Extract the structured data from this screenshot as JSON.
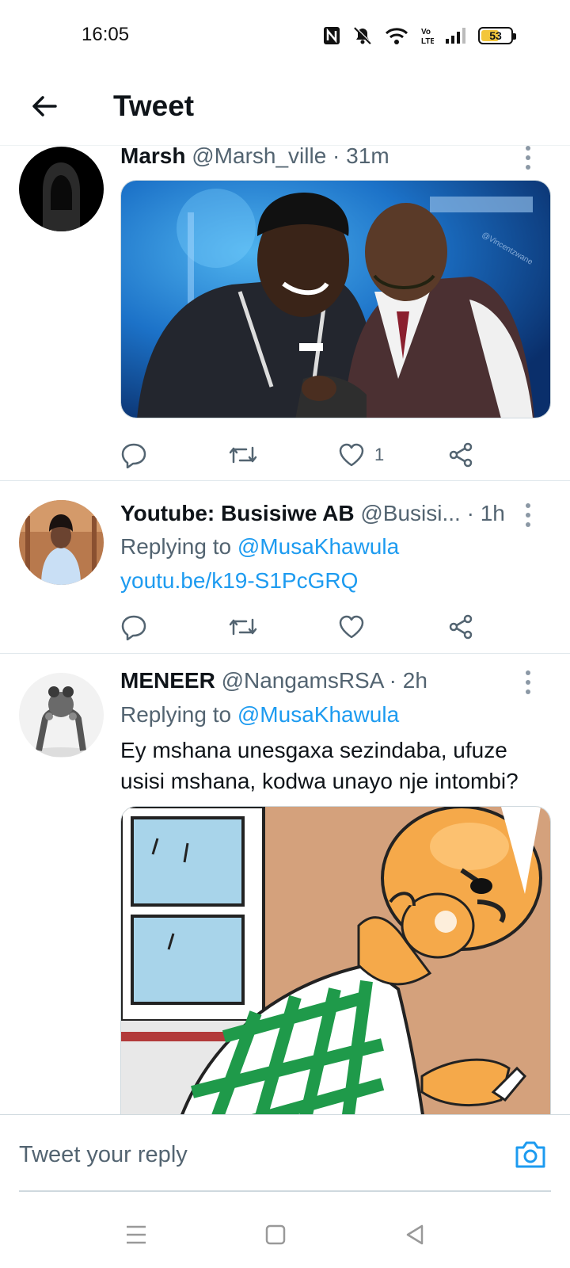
{
  "status_bar": {
    "time": "16:05",
    "battery": "53",
    "icons": [
      "nfc-icon",
      "mute-icon",
      "wifi-icon",
      "volte-icon",
      "signal-icon",
      "battery-icon"
    ]
  },
  "header": {
    "title": "Tweet",
    "back_icon": "arrow-left-icon"
  },
  "tweets": [
    {
      "name": "Marsh",
      "handle": "@Marsh_ville",
      "time": "31m",
      "separator": " · ",
      "likes": "1",
      "image_watermark": "@Vincentzwane"
    },
    {
      "name": "Youtube: Busisiwe AB",
      "handle": "@Busisi...",
      "time": "1h",
      "separator": " · ",
      "replying_prefix": "Replying to ",
      "replying_to": "@MusaKhawula",
      "link": "youtu.be/k19-S1PcGRQ"
    },
    {
      "name": "MENEER",
      "handle": "@NangamsRSA",
      "time": "2h",
      "separator": " · ",
      "replying_prefix": "Replying to ",
      "replying_to": "@MusaKhawula",
      "text": "Ey mshana unesgaxa sezindaba, ufuze usisi mshana, kodwa unayo nje intombi?"
    }
  ],
  "reply_bar": {
    "placeholder": "Tweet your reply"
  },
  "colors": {
    "accent": "#1d9bf0",
    "text": "#0f1419",
    "secondary": "#536471",
    "divider": "#e1e8ed",
    "battery": "#f3c63b"
  }
}
